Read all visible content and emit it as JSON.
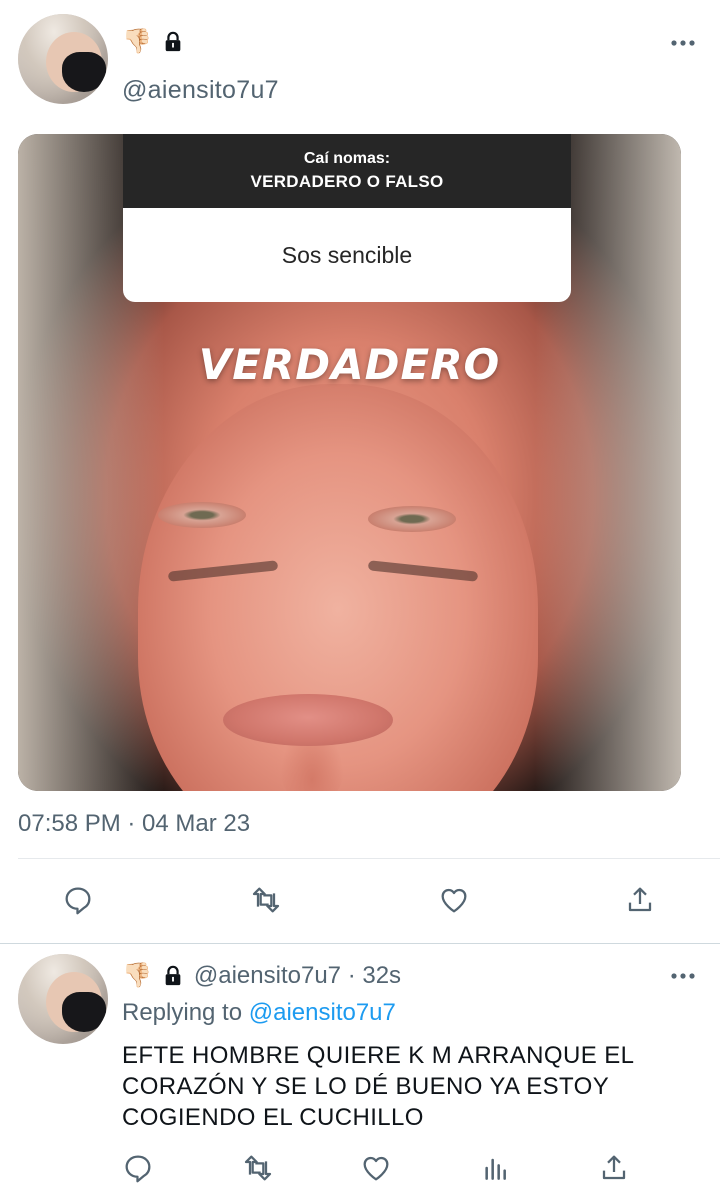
{
  "tweet": {
    "badges": {
      "emoji": "👎🏻",
      "lock_icon": "lock-icon"
    },
    "handle": "@aiensito7u7",
    "more_icon": "more-horizontal-icon",
    "media": {
      "question_title": "Caí nomas:",
      "question_subtitle": "VERDADERO O FALSO",
      "answer": "Sos sencible",
      "overlay_text": "VERDADERO"
    },
    "timestamp": "07:58 PM · 04 Mar 23",
    "actions": [
      "reply-icon",
      "retweet-icon",
      "like-icon",
      "share-icon"
    ]
  },
  "reply": {
    "badges": {
      "emoji": "👎🏻",
      "lock_icon": "lock-icon"
    },
    "handle": "@aiensito7u7 · 32s",
    "replying_prefix": "Replying to",
    "replying_handle": "@aiensito7u7",
    "text": "EFTE HOMBRE QUIERE K M ARRANQUE EL CORAZÓN Y SE LO DÉ BUENO YA ESTOY COGIENDO EL CUCHILLO",
    "actions": [
      "reply-icon",
      "retweet-icon",
      "like-icon",
      "analytics-icon",
      "share-icon"
    ]
  },
  "colors": {
    "secondary_text": "#536471",
    "link": "#1d9bf0",
    "divider": "#e6e9ec"
  }
}
